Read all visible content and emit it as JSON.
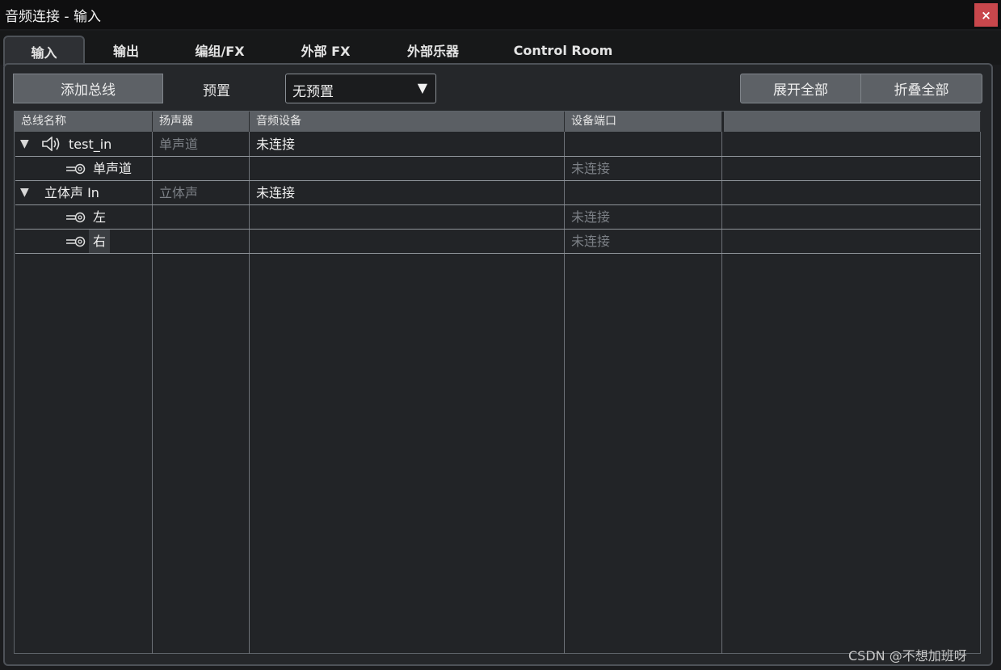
{
  "window": {
    "title": "音频连接 - 输入",
    "close_label": "×"
  },
  "tabs": [
    {
      "label": "输入",
      "active": true
    },
    {
      "label": "输出"
    },
    {
      "label": "编组/FX"
    },
    {
      "label": "外部 FX"
    },
    {
      "label": "外部乐器"
    },
    {
      "label": "Control Room"
    }
  ],
  "toolbar": {
    "add_bus_label": "添加总线",
    "preset_label": "预置",
    "preset_value": "无预置",
    "expand_all_label": "展开全部",
    "collapse_all_label": "折叠全部"
  },
  "table": {
    "columns": [
      "总线名称",
      "扬声器",
      "音频设备",
      "设备端口",
      ""
    ],
    "rows": [
      {
        "name": "test_in",
        "speaker": "单声道",
        "device": "未连接",
        "port": "",
        "type": "bus",
        "icon": "speaker-icon",
        "expanded": true
      },
      {
        "name": "单声道",
        "speaker": "",
        "device": "",
        "port": "未连接",
        "type": "channel",
        "icon": "input-plug-icon"
      },
      {
        "name": "立体声 In",
        "speaker": "立体声",
        "device": "未连接",
        "port": "",
        "type": "bus",
        "expanded": true
      },
      {
        "name": "左",
        "speaker": "",
        "device": "",
        "port": "未连接",
        "type": "channel",
        "icon": "input-plug-icon"
      },
      {
        "name": "右",
        "speaker": "",
        "device": "",
        "port": "未连接",
        "type": "channel",
        "icon": "input-plug-icon",
        "selected": true
      }
    ]
  },
  "watermark": "CSDN @不想加班呀",
  "colors": {
    "close": "#c8474c",
    "panel": "#25272a",
    "header": "#5b5f64"
  }
}
